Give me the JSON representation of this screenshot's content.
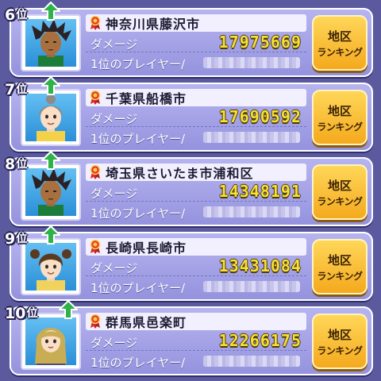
{
  "rows": [
    {
      "rank": "6",
      "unit": "位",
      "region": "神奈川県藤沢市",
      "damage_label": "ダメージ",
      "damage": "17975669",
      "top_player_label": "1位のプレイヤー/",
      "button_line1": "地区",
      "button_line2": "ランキング",
      "avatar": "spiky-dark-hair"
    },
    {
      "rank": "7",
      "unit": "位",
      "region": "千葉県船橋市",
      "damage_label": "ダメージ",
      "damage": "17690592",
      "top_player_label": "1位のプレイヤー/",
      "button_line1": "地区",
      "button_line2": "ランキング",
      "avatar": "gray-hair-bun"
    },
    {
      "rank": "8",
      "unit": "位",
      "region": "埼玉県さいたま市浦和区",
      "damage_label": "ダメージ",
      "damage": "14348191",
      "top_player_label": "1位のプレイヤー/",
      "button_line1": "地区",
      "button_line2": "ランキング",
      "avatar": "spiky-dark-hair"
    },
    {
      "rank": "9",
      "unit": "位",
      "region": "長崎県長崎市",
      "damage_label": "ダメージ",
      "damage": "13431084",
      "top_player_label": "1位のプレイヤー/",
      "button_line1": "地区",
      "button_line2": "ランキング",
      "avatar": "brown-hair-pigtails"
    },
    {
      "rank": "10",
      "unit": "位",
      "region": "群馬県邑楽町",
      "damage_label": "ダメージ",
      "damage": "12266175",
      "top_player_label": "1位のプレイヤー/",
      "button_line1": "地区",
      "button_line2": "ランキング",
      "avatar": "long-blonde-hair"
    }
  ],
  "colors": {
    "card_bg": "#a5a3e8",
    "damage_text": "#f8df3a",
    "button_bg": "#f8c53a",
    "rank_up_arrow": "#2fb24a",
    "region_icon": "#d92b2b"
  },
  "icons": {
    "rank_change": "up-arrow-icon",
    "region": "medal-ribbon-icon"
  }
}
